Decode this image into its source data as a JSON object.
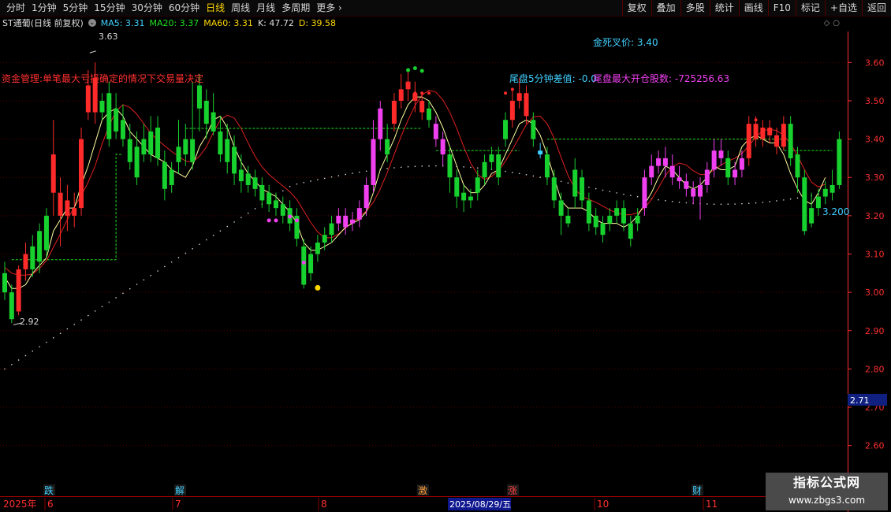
{
  "toolbar": {
    "left": [
      "分时",
      "1分钟",
      "5分钟",
      "15分钟",
      "30分钟",
      "60分钟",
      "日线",
      "周线",
      "月线",
      "多周期",
      "更多"
    ],
    "active": "日线",
    "right": [
      "复权",
      "叠加",
      "多股",
      "统计",
      "画线",
      "F10",
      "标记",
      "+自选",
      "返回"
    ]
  },
  "header": {
    "stock": "ST通葡(日线 前复权)",
    "ma5": "MA5: 3.31",
    "ma20": "MA20: 3.37",
    "ma60": "MA60: 3.31",
    "k": "K: 47.72",
    "d": "D: 39.58"
  },
  "colors": {
    "up": "#ff2a2a",
    "down": "#17d12e",
    "magenta": "#f040f0",
    "ma5": "#ffffa0",
    "ma20": "#e02020",
    "ma60": "#d8d8d8",
    "dash": "#20e020",
    "axis": "#ff3030",
    "cyan": "#40d0ff",
    "yellow": "#ffd700"
  },
  "annotations": {
    "risk_text": "资金管理:单笔最大亏损确定的情况下交易量决定",
    "golden_cross": "金死叉价: 3.40",
    "tail_diff": "尾盘5分钟差值: -0.0",
    "tail_max": "尾盘最大开仓股数: -725256.63",
    "high_label": "3.63",
    "low_label": "2.92",
    "price_tag_chart": "3.200",
    "price_tag_axis": "2.71"
  },
  "timeline": {
    "year": "2025年",
    "months": [
      "6",
      "7",
      "8",
      "10",
      "11"
    ],
    "cursor_date": "2025/08/29/五",
    "markers": [
      "跌",
      "解",
      "激",
      "涨",
      "财"
    ]
  },
  "watermark": {
    "line1": "指标公式网",
    "line2": "www.zbgs3.com"
  },
  "chart_data": {
    "type": "candlestick",
    "ylim": [
      2.55,
      3.65
    ],
    "y_ticks": [
      "3.60",
      "3.50",
      "3.40",
      "3.30",
      "3.20",
      "3.10",
      "3.00",
      "2.90",
      "2.80",
      "2.70",
      "2.60"
    ],
    "candles": [
      [
        3.05,
        3.0,
        3.08,
        2.98,
        "down"
      ],
      [
        3.0,
        2.93,
        3.02,
        2.92,
        "down"
      ],
      [
        2.95,
        3.06,
        3.07,
        2.94,
        "up"
      ],
      [
        3.06,
        3.1,
        3.13,
        3.03,
        "up"
      ],
      [
        3.12,
        3.06,
        3.15,
        3.04,
        "down"
      ],
      [
        3.16,
        3.08,
        3.18,
        3.05,
        "down"
      ],
      [
        3.2,
        3.11,
        3.22,
        3.09,
        "down"
      ],
      [
        3.26,
        3.36,
        3.45,
        3.2,
        "up"
      ],
      [
        3.2,
        3.26,
        3.3,
        3.12,
        "up"
      ],
      [
        3.2,
        3.24,
        3.28,
        3.16,
        "up"
      ],
      [
        3.2,
        3.22,
        3.26,
        3.17,
        "up"
      ],
      [
        3.22,
        3.4,
        3.43,
        3.2,
        "up"
      ],
      [
        3.47,
        3.54,
        3.58,
        3.45,
        "up"
      ],
      [
        3.47,
        3.56,
        3.6,
        3.44,
        "up"
      ],
      [
        3.5,
        3.47,
        3.52,
        3.45,
        "down"
      ],
      [
        3.52,
        3.4,
        3.55,
        3.38,
        "down"
      ],
      [
        3.48,
        3.42,
        3.52,
        3.4,
        "down"
      ],
      [
        3.45,
        3.4,
        3.49,
        3.38,
        "down"
      ],
      [
        3.4,
        3.34,
        3.44,
        3.32,
        "down"
      ],
      [
        3.38,
        3.3,
        3.42,
        3.28,
        "down"
      ],
      [
        3.36,
        3.4,
        3.44,
        3.34,
        "down"
      ],
      [
        3.42,
        3.36,
        3.46,
        3.34,
        "down"
      ],
      [
        3.43,
        3.35,
        3.46,
        3.33,
        "down"
      ],
      [
        3.34,
        3.27,
        3.37,
        3.24,
        "down"
      ],
      [
        3.32,
        3.28,
        3.34,
        3.26,
        "down"
      ],
      [
        3.38,
        3.34,
        3.45,
        3.31,
        "down"
      ],
      [
        3.4,
        3.36,
        3.44,
        3.33,
        "down"
      ],
      [
        3.34,
        3.4,
        3.55,
        3.32,
        "down"
      ],
      [
        3.48,
        3.54,
        3.57,
        3.42,
        "down"
      ],
      [
        3.5,
        3.44,
        3.53,
        3.4,
        "down"
      ],
      [
        3.47,
        3.42,
        3.52,
        3.41,
        "down"
      ],
      [
        3.42,
        3.36,
        3.46,
        3.34,
        "down"
      ],
      [
        3.4,
        3.34,
        3.44,
        3.31,
        "down"
      ],
      [
        3.38,
        3.31,
        3.41,
        3.28,
        "down"
      ],
      [
        3.32,
        3.29,
        3.36,
        3.26,
        "down"
      ],
      [
        3.31,
        3.28,
        3.33,
        3.26,
        "down"
      ],
      [
        3.3,
        3.27,
        3.32,
        3.25,
        "down"
      ],
      [
        3.28,
        3.24,
        3.3,
        3.22,
        "down"
      ],
      [
        3.26,
        3.23,
        3.28,
        3.21,
        "down"
      ],
      [
        3.24,
        3.22,
        3.26,
        3.2,
        "down"
      ],
      [
        3.23,
        3.2,
        3.25,
        3.18,
        "down"
      ],
      [
        3.22,
        3.18,
        3.24,
        3.16,
        "down"
      ],
      [
        3.2,
        3.14,
        3.22,
        3.12,
        "down"
      ],
      [
        3.12,
        3.02,
        3.14,
        3.01,
        "down"
      ],
      [
        3.05,
        3.1,
        3.12,
        3.03,
        "down"
      ],
      [
        3.1,
        3.13,
        3.15,
        3.08,
        "down"
      ],
      [
        3.13,
        3.15,
        3.17,
        3.11,
        "down"
      ],
      [
        3.15,
        3.18,
        3.2,
        3.13,
        "down"
      ],
      [
        3.18,
        3.2,
        3.22,
        3.16,
        "magenta"
      ],
      [
        3.2,
        3.17,
        3.22,
        3.15,
        "magenta"
      ],
      [
        3.18,
        3.19,
        3.21,
        3.16,
        "magenta"
      ],
      [
        3.19,
        3.22,
        3.24,
        3.17,
        "magenta"
      ],
      [
        3.22,
        3.28,
        3.3,
        3.2,
        "magenta"
      ],
      [
        3.28,
        3.4,
        3.45,
        3.26,
        "magenta"
      ],
      [
        3.4,
        3.48,
        3.5,
        3.37,
        "magenta"
      ],
      [
        3.4,
        3.36,
        3.44,
        3.34,
        "down"
      ],
      [
        3.44,
        3.5,
        3.52,
        3.42,
        "up"
      ],
      [
        3.5,
        3.53,
        3.57,
        3.48,
        "up"
      ],
      [
        3.53,
        3.55,
        3.58,
        3.5,
        "up"
      ],
      [
        3.52,
        3.5,
        3.55,
        3.47,
        "up"
      ],
      [
        3.5,
        3.47,
        3.52,
        3.45,
        "up"
      ],
      [
        3.48,
        3.45,
        3.5,
        3.43,
        "down"
      ],
      [
        3.44,
        3.4,
        3.46,
        3.38,
        "magenta"
      ],
      [
        3.4,
        3.36,
        3.42,
        3.33,
        "magenta"
      ],
      [
        3.36,
        3.3,
        3.38,
        3.26,
        "down"
      ],
      [
        3.3,
        3.25,
        3.32,
        3.22,
        "down"
      ],
      [
        3.26,
        3.24,
        3.28,
        3.21,
        "down"
      ],
      [
        3.25,
        3.24,
        3.27,
        3.22,
        "down"
      ],
      [
        3.26,
        3.3,
        3.32,
        3.24,
        "down"
      ],
      [
        3.3,
        3.34,
        3.36,
        3.28,
        "down"
      ],
      [
        3.34,
        3.36,
        3.38,
        3.32,
        "down"
      ],
      [
        3.36,
        3.3,
        3.38,
        3.28,
        "down"
      ],
      [
        3.4,
        3.45,
        3.47,
        3.38,
        "down"
      ],
      [
        3.45,
        3.5,
        3.53,
        3.43,
        "up"
      ],
      [
        3.5,
        3.52,
        3.56,
        3.48,
        "up"
      ],
      [
        3.52,
        3.46,
        3.54,
        3.44,
        "up"
      ],
      [
        3.45,
        3.4,
        3.47,
        3.38,
        "down"
      ],
      [
        3.37,
        3.36,
        3.39,
        3.35,
        "cyan"
      ],
      [
        3.36,
        3.3,
        3.38,
        3.28,
        "down"
      ],
      [
        3.3,
        3.24,
        3.32,
        3.22,
        "down"
      ],
      [
        3.24,
        3.2,
        3.26,
        3.15,
        "down"
      ],
      [
        3.2,
        3.18,
        3.22,
        3.17,
        "down"
      ],
      [
        3.25,
        3.32,
        3.35,
        3.22,
        "down"
      ],
      [
        3.3,
        3.24,
        3.32,
        3.22,
        "down"
      ],
      [
        3.24,
        3.18,
        3.26,
        3.16,
        "down"
      ],
      [
        3.2,
        3.17,
        3.22,
        3.15,
        "down"
      ],
      [
        3.18,
        3.15,
        3.2,
        3.13,
        "down"
      ],
      [
        3.18,
        3.2,
        3.22,
        3.16,
        "down"
      ],
      [
        3.2,
        3.22,
        3.24,
        3.18,
        "down"
      ],
      [
        3.22,
        3.18,
        3.24,
        3.16,
        "down"
      ],
      [
        3.18,
        3.14,
        3.2,
        3.12,
        "down"
      ],
      [
        3.18,
        3.2,
        3.22,
        3.16,
        "down"
      ],
      [
        3.22,
        3.3,
        3.32,
        3.2,
        "magenta"
      ],
      [
        3.3,
        3.33,
        3.36,
        3.28,
        "magenta"
      ],
      [
        3.33,
        3.35,
        3.37,
        3.31,
        "magenta"
      ],
      [
        3.35,
        3.33,
        3.38,
        3.3,
        "magenta"
      ],
      [
        3.33,
        3.3,
        3.36,
        3.28,
        "magenta"
      ],
      [
        3.3,
        3.29,
        3.33,
        3.27,
        "magenta"
      ],
      [
        3.29,
        3.27,
        3.31,
        3.25,
        "magenta"
      ],
      [
        3.27,
        3.25,
        3.29,
        3.23,
        "magenta"
      ],
      [
        3.25,
        3.28,
        3.3,
        3.19,
        "magenta"
      ],
      [
        3.28,
        3.32,
        3.34,
        3.26,
        "magenta"
      ],
      [
        3.32,
        3.37,
        3.4,
        3.3,
        "magenta"
      ],
      [
        3.37,
        3.35,
        3.4,
        3.33,
        "magenta"
      ],
      [
        3.35,
        3.3,
        3.37,
        3.28,
        "down"
      ],
      [
        3.3,
        3.32,
        3.34,
        3.28,
        "magenta"
      ],
      [
        3.32,
        3.35,
        3.37,
        3.3,
        "magenta"
      ],
      [
        3.35,
        3.44,
        3.46,
        3.33,
        "up"
      ],
      [
        3.44,
        3.4,
        3.46,
        3.38,
        "up"
      ],
      [
        3.4,
        3.43,
        3.45,
        3.38,
        "up"
      ],
      [
        3.43,
        3.41,
        3.45,
        3.39,
        "up"
      ],
      [
        3.41,
        3.38,
        3.43,
        3.36,
        "up"
      ],
      [
        3.38,
        3.44,
        3.46,
        3.37,
        "up"
      ],
      [
        3.44,
        3.35,
        3.46,
        3.33,
        "down"
      ],
      [
        3.36,
        3.3,
        3.38,
        3.26,
        "down"
      ],
      [
        3.3,
        3.16,
        3.32,
        3.15,
        "down"
      ],
      [
        3.18,
        3.22,
        3.26,
        3.17,
        "down"
      ],
      [
        3.22,
        3.25,
        3.27,
        3.2,
        "down"
      ],
      [
        3.25,
        3.27,
        3.29,
        3.23,
        "down"
      ],
      [
        3.26,
        3.28,
        3.32,
        3.24,
        "down"
      ],
      [
        3.28,
        3.4,
        3.42,
        3.27,
        "down"
      ]
    ],
    "ma5": [
      3.04,
      3.01,
      3.01,
      3.02,
      3.05,
      3.07,
      3.09,
      3.16,
      3.19,
      3.22,
      3.22,
      3.28,
      3.33,
      3.39,
      3.45,
      3.47,
      3.48,
      3.46,
      3.42,
      3.4,
      3.38,
      3.36,
      3.35,
      3.34,
      3.32,
      3.31,
      3.3,
      3.33,
      3.38,
      3.41,
      3.45,
      3.46,
      3.43,
      3.38,
      3.34,
      3.31,
      3.29,
      3.27,
      3.26,
      3.25,
      3.23,
      3.21,
      3.18,
      3.13,
      3.11,
      3.11,
      3.12,
      3.13,
      3.15,
      3.17,
      3.18,
      3.19,
      3.21,
      3.26,
      3.32,
      3.36,
      3.4,
      3.45,
      3.49,
      3.51,
      3.51,
      3.5,
      3.47,
      3.43,
      3.38,
      3.33,
      3.28,
      3.26,
      3.26,
      3.28,
      3.31,
      3.32,
      3.36,
      3.4,
      3.44,
      3.45,
      3.44,
      3.41,
      3.36,
      3.3,
      3.24,
      3.22,
      3.22,
      3.22,
      3.21,
      3.19,
      3.18,
      3.18,
      3.18,
      3.17,
      3.18,
      3.2,
      3.23,
      3.26,
      3.3,
      3.33,
      3.32,
      3.3,
      3.28,
      3.27,
      3.28,
      3.3,
      3.33,
      3.32,
      3.32,
      3.33,
      3.38,
      3.4,
      3.41,
      3.4,
      3.39,
      3.39,
      3.36,
      3.31,
      3.27,
      3.24,
      3.23,
      3.26,
      3.3
    ]
  }
}
